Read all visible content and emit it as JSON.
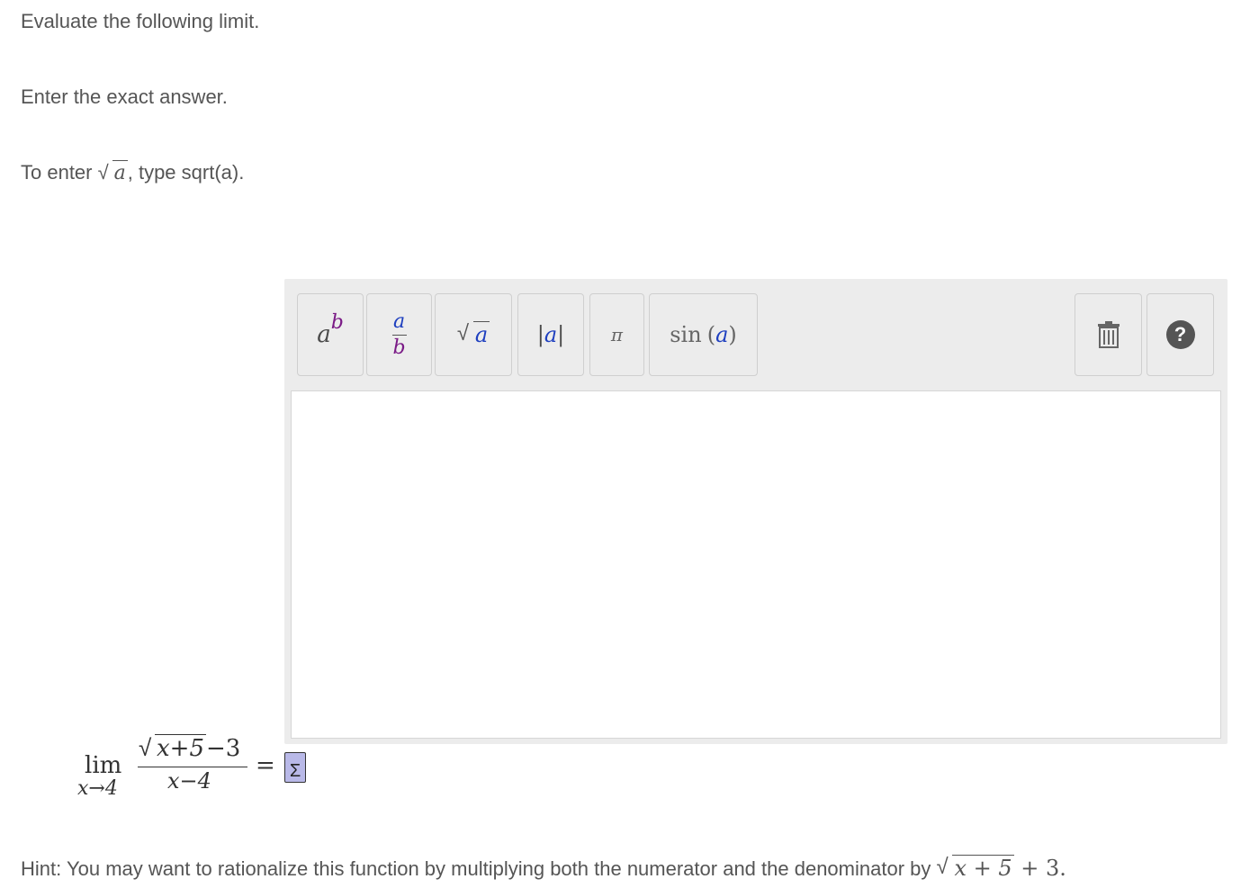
{
  "instructions": {
    "line1": "Evaluate the following limit.",
    "line2": "Enter the exact answer.",
    "line3_before": "To enter ",
    "line3_math": "a",
    "line3_after": ", type sqrt(a)."
  },
  "toolbar": {
    "buttons": [
      {
        "name": "power",
        "base": "a",
        "exp": "b"
      },
      {
        "name": "fraction",
        "num": "a",
        "den": "b"
      },
      {
        "name": "sqrt",
        "arg": "a"
      },
      {
        "name": "abs",
        "arg": "a"
      },
      {
        "name": "pi",
        "symbol": "π"
      },
      {
        "name": "sin",
        "fn": "sin",
        "arg": "a"
      }
    ],
    "trash_icon": "trash-icon",
    "help_icon": "question-circle-icon",
    "help_symbol": "?"
  },
  "problem": {
    "lim_word": "lim",
    "lim_sub": "x→4",
    "numerator_sqrt": "x+5",
    "numerator_rest": "−3",
    "denominator": "x−4",
    "equals": "=",
    "answer_icon": "equation-editor-icon",
    "answer_icon_symbol": "Σ"
  },
  "hint": {
    "text": "Hint: You may want to rationalize this function by multiplying both the numerator and the denominator by ",
    "sqrt_arg": "x + 5",
    "tail": " + 3."
  }
}
